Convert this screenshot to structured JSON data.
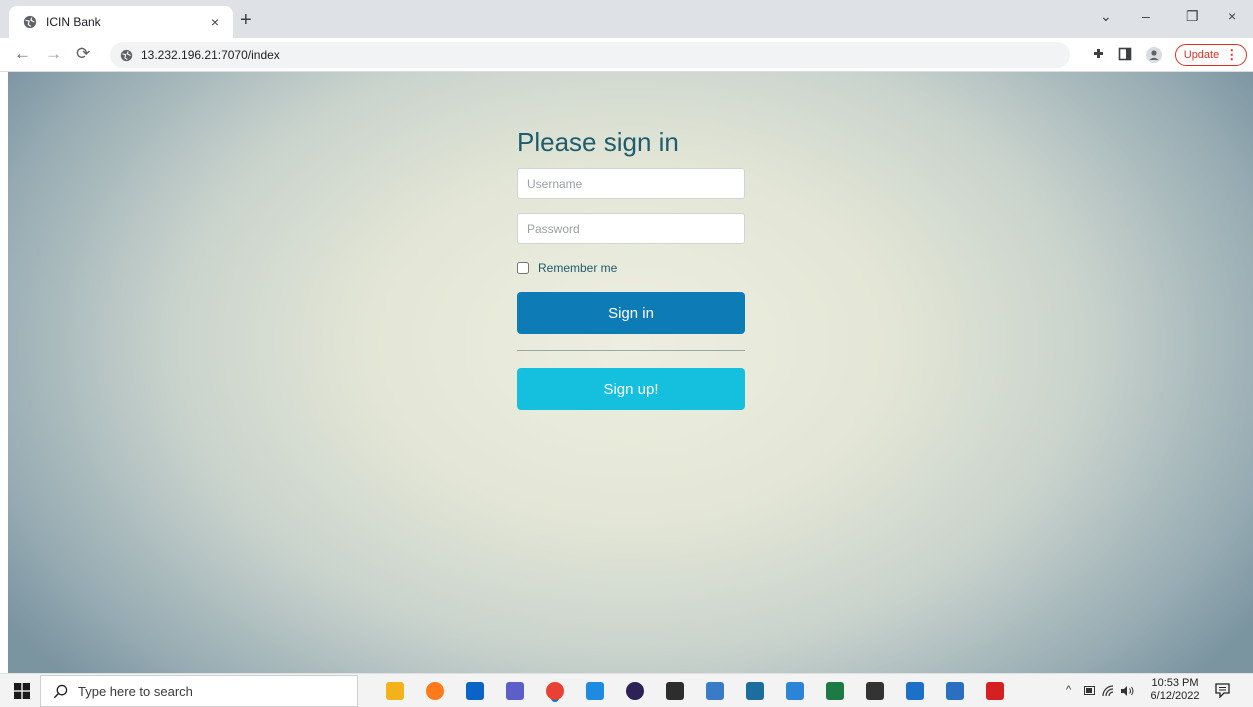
{
  "browser": {
    "tab_title": "ICIN Bank",
    "tab_close": "×",
    "new_tab": "+",
    "url": "13.232.196.21:7070/index",
    "update_label": "Update",
    "update_menu": "⋮",
    "window_controls": {
      "dropdown": "⌄",
      "minimize": "–",
      "restore": "❐",
      "close": "×"
    }
  },
  "login": {
    "heading": "Please sign in",
    "username_placeholder": "Username",
    "password_placeholder": "Password",
    "remember_label": "Remember me",
    "signin_label": "Sign in",
    "signup_label": "Sign up!"
  },
  "taskbar": {
    "search_placeholder": "Type here to search",
    "time": "10:53 PM",
    "date": "6/12/2022",
    "apps": [
      {
        "name": "file-explorer-icon",
        "color": "#f3b21c"
      },
      {
        "name": "firefox-icon",
        "color": "#ff7a1a"
      },
      {
        "name": "outlook-icon",
        "color": "#0a64c8"
      },
      {
        "name": "teams-icon",
        "color": "#5b5fc7"
      },
      {
        "name": "chrome-icon",
        "color": "#e94235"
      },
      {
        "name": "vscode-icon",
        "color": "#1e8ae0"
      },
      {
        "name": "eclipse-icon",
        "color": "#2c2255"
      },
      {
        "name": "terminal-icon",
        "color": "#2d2d2d"
      },
      {
        "name": "notepad-icon",
        "color": "#3a7bc8"
      },
      {
        "name": "mysql-workbench-icon",
        "color": "#1b6e9e"
      },
      {
        "name": "paint-icon",
        "color": "#2b84d6"
      },
      {
        "name": "excel-icon",
        "color": "#1d7a44"
      },
      {
        "name": "settings-icon",
        "color": "#333333"
      },
      {
        "name": "photos-icon",
        "color": "#1d70c8"
      },
      {
        "name": "network-icon",
        "color": "#2a6fc0"
      },
      {
        "name": "sticky-app-icon",
        "color": "#d42020"
      }
    ]
  }
}
